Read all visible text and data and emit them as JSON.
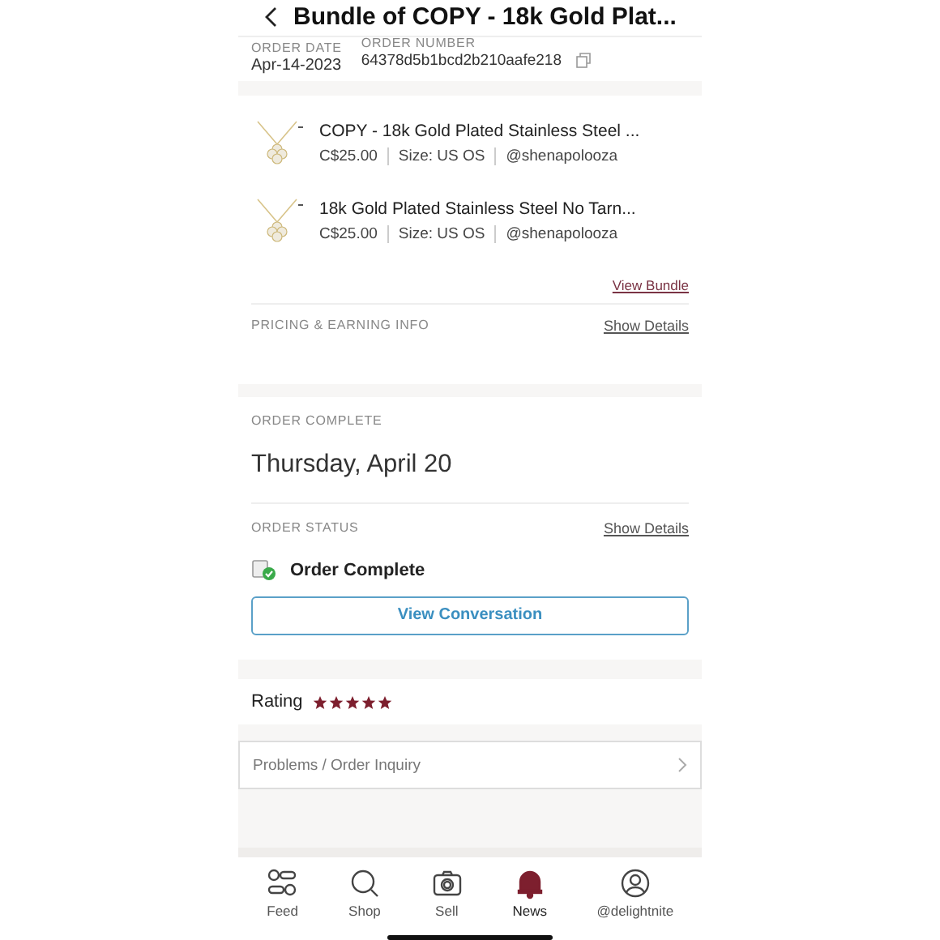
{
  "header": {
    "title": "Bundle of COPY - 18k Gold Plat..."
  },
  "order_info": {
    "date_label": "ORDER DATE",
    "date": "Apr-14-2023",
    "number_label": "ORDER NUMBER",
    "number": "64378d5b1bcd2b210aafe218"
  },
  "items": [
    {
      "title": "COPY - 18k Gold Plated Stainless Steel ...",
      "price": "C$25.00",
      "size": "Size: US OS",
      "seller": "@shenapolooza"
    },
    {
      "title": "18k Gold Plated Stainless Steel No Tarn...",
      "price": "C$25.00",
      "size": "Size: US OS",
      "seller": "@shenapolooza"
    }
  ],
  "view_bundle": "View Bundle",
  "pricing": {
    "label": "PRICING & EARNING INFO",
    "action": "Show Details"
  },
  "completion": {
    "label": "ORDER COMPLETE",
    "date": "Thursday, April 20"
  },
  "status": {
    "label": "ORDER STATUS",
    "action": "Show Details",
    "value": "Order Complete",
    "button": "View Conversation"
  },
  "rating": {
    "label": "Rating",
    "stars": 5
  },
  "inquiry": "Problems / Order Inquiry",
  "tab_bar": [
    {
      "label": "Feed",
      "kind": "feed",
      "selected": false
    },
    {
      "label": "Shop",
      "kind": "shop",
      "selected": false
    },
    {
      "label": "Sell",
      "kind": "sell",
      "selected": false
    },
    {
      "label": "News",
      "kind": "news",
      "selected": true
    },
    {
      "label": "@delightnite",
      "kind": "profile",
      "selected": false
    }
  ]
}
